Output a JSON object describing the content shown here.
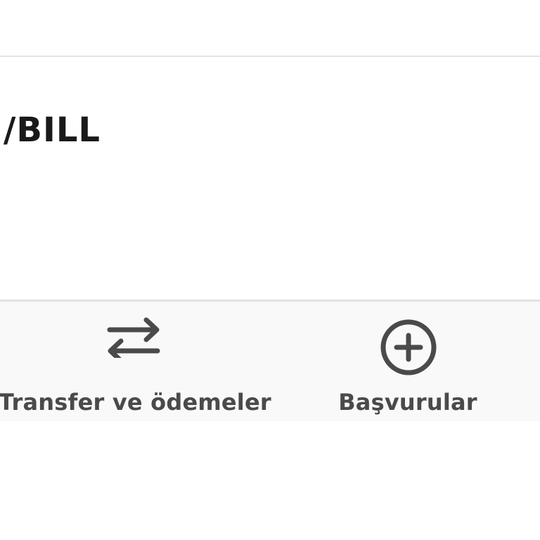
{
  "card": {
    "title": "I/BILL"
  },
  "bottom_nav": {
    "items": [
      {
        "label": "Transfer ve ödemeler",
        "icon": "swap-arrows-icon"
      },
      {
        "label": "Başvurular",
        "icon": "plus-circle-icon"
      }
    ]
  },
  "colors": {
    "icon": "#4a4a4a",
    "nav_background": "#f9f9f9",
    "divider": "#e2e2e2"
  }
}
